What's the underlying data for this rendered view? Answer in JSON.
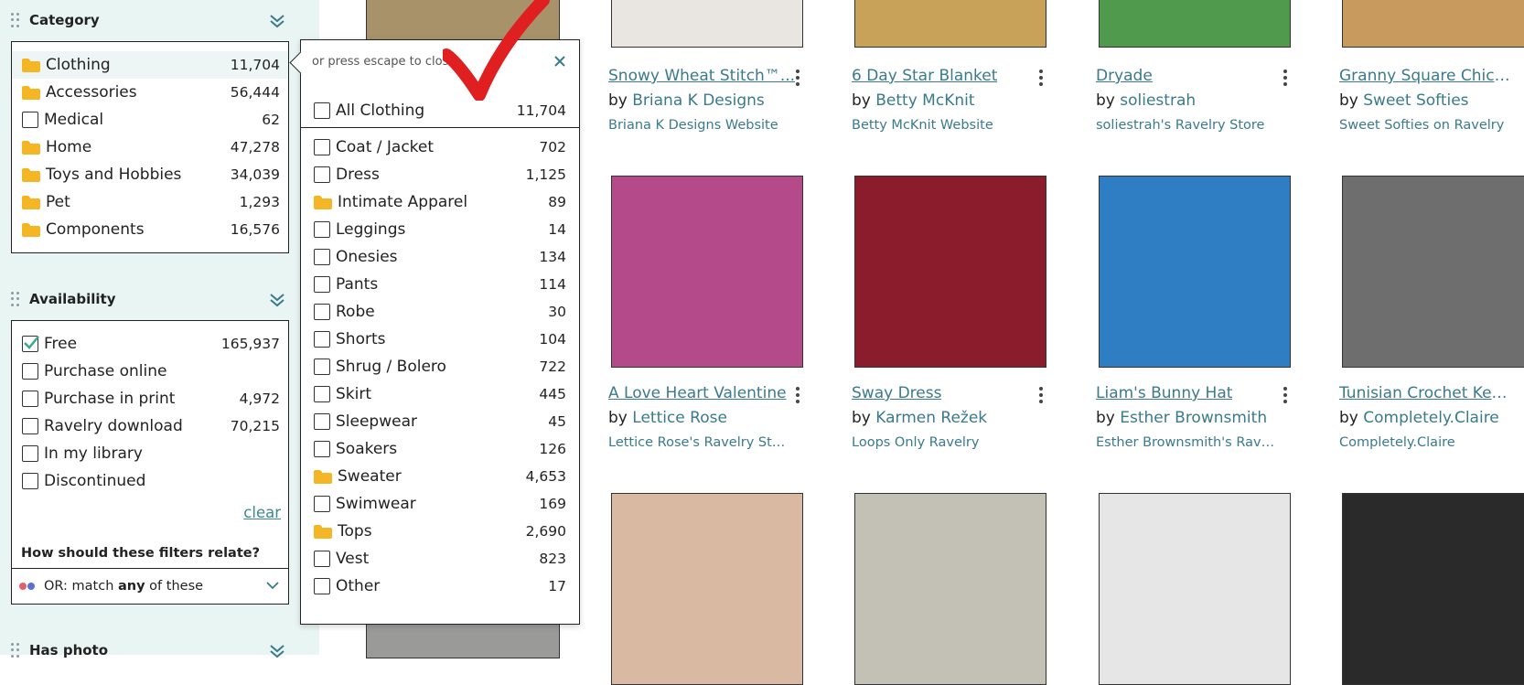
{
  "sidebar": {
    "category": {
      "title": "Category",
      "items": [
        {
          "label": "Clothing",
          "count": "11,704",
          "type": "folder"
        },
        {
          "label": "Accessories",
          "count": "56,444",
          "type": "folder"
        },
        {
          "label": "Medical",
          "count": "62",
          "type": "checkbox"
        },
        {
          "label": "Home",
          "count": "47,278",
          "type": "folder"
        },
        {
          "label": "Toys and Hobbies",
          "count": "34,039",
          "type": "folder"
        },
        {
          "label": "Pet",
          "count": "1,293",
          "type": "folder"
        },
        {
          "label": "Components",
          "count": "16,576",
          "type": "folder"
        }
      ]
    },
    "availability": {
      "title": "Availability",
      "items": [
        {
          "label": "Free",
          "count": "165,937",
          "checked": true
        },
        {
          "label": "Purchase online",
          "count": ""
        },
        {
          "label": "Purchase in print",
          "count": "4,972"
        },
        {
          "label": "Ravelry download",
          "count": "70,215"
        },
        {
          "label": "In my library",
          "count": ""
        },
        {
          "label": "Discontinued",
          "count": ""
        }
      ],
      "clear_label": "clear",
      "relate_question": "How should these filters relate?",
      "relate_prefix": "OR: match ",
      "relate_strong": "any",
      "relate_suffix": " of these",
      "dot_colors": [
        "#e2606b",
        "#5a6fd8"
      ]
    },
    "has_photo": {
      "title": "Has photo"
    }
  },
  "popup": {
    "hint": "or press escape to close",
    "all": {
      "label": "All Clothing",
      "count": "11,704"
    },
    "items": [
      {
        "label": "Coat / Jacket",
        "count": "702",
        "type": "checkbox"
      },
      {
        "label": "Dress",
        "count": "1,125",
        "type": "checkbox"
      },
      {
        "label": "Intimate Apparel",
        "count": "89",
        "type": "folder"
      },
      {
        "label": "Leggings",
        "count": "14",
        "type": "checkbox"
      },
      {
        "label": "Onesies",
        "count": "134",
        "type": "checkbox"
      },
      {
        "label": "Pants",
        "count": "114",
        "type": "checkbox"
      },
      {
        "label": "Robe",
        "count": "30",
        "type": "checkbox"
      },
      {
        "label": "Shorts",
        "count": "104",
        "type": "checkbox"
      },
      {
        "label": "Shrug / Bolero",
        "count": "722",
        "type": "checkbox"
      },
      {
        "label": "Skirt",
        "count": "445",
        "type": "checkbox"
      },
      {
        "label": "Sleepwear",
        "count": "45",
        "type": "checkbox"
      },
      {
        "label": "Soakers",
        "count": "126",
        "type": "checkbox"
      },
      {
        "label": "Sweater",
        "count": "4,653",
        "type": "folder"
      },
      {
        "label": "Swimwear",
        "count": "169",
        "type": "checkbox"
      },
      {
        "label": "Tops",
        "count": "2,690",
        "type": "folder"
      },
      {
        "label": "Vest",
        "count": "823",
        "type": "checkbox"
      },
      {
        "label": "Other",
        "count": "17",
        "type": "checkbox"
      }
    ]
  },
  "patterns": [
    {
      "title": "Snowy Wheat Stitch™...",
      "by": "by ",
      "designer": "Briana K Designs",
      "source": "Briana K Designs Website",
      "thumb_color": "#e9e6e1"
    },
    {
      "title": "6 Day Star Blanket",
      "by": "by ",
      "designer": "Betty McKnit",
      "source": "Betty McKnit Website",
      "thumb_color": "#c9a25a"
    },
    {
      "title": "Dryade",
      "by": "by ",
      "designer": "soliestrah",
      "source": "soliestrah's Ravelry Store",
      "thumb_color": "#4f9a4c"
    },
    {
      "title": "Granny Square Chicken",
      "by": "by ",
      "designer": "Sweet Softies",
      "source": "Sweet Softies on Ravelry",
      "thumb_color": "#c99a5e"
    },
    {
      "title": "A Love Heart Valentine",
      "by": "by ",
      "designer": "Lettice Rose",
      "source": "Lettice Rose's Ravelry Store",
      "thumb_color": "#b44a8a"
    },
    {
      "title": "Sway Dress",
      "by": "by ",
      "designer": "Karmen Režek",
      "source": "Loops Only Ravelry",
      "thumb_color": "#8a1c2c"
    },
    {
      "title": "Liam's Bunny Hat",
      "by": "by ",
      "designer": "Esther Brownsmith",
      "source": "Esther Brownsmith's Rave...",
      "thumb_color": "#2f7ec4"
    },
    {
      "title": "Tunisian Crochet Key...",
      "by": "by ",
      "designer": "Completely.Claire",
      "source": "Completely.Claire",
      "thumb_color": "#6e6e6e"
    },
    {
      "title": "",
      "by": "",
      "designer": "",
      "source": "",
      "thumb_color": "#d9b9a2"
    },
    {
      "title": "",
      "by": "",
      "designer": "",
      "source": "",
      "thumb_color": "#c3c0b6"
    },
    {
      "title": "",
      "by": "",
      "designer": "",
      "source": "",
      "thumb_color": "#e6e6e6"
    },
    {
      "title": "",
      "by": "",
      "designer": "",
      "source": "",
      "thumb_color": "#2a2a2a"
    }
  ],
  "colors": {
    "accent": "#3a7a8c",
    "sidebar_bg": "#e9f5f3",
    "folder": "#f4b624",
    "check": "#3aa88c",
    "annotation": "#e02020"
  }
}
